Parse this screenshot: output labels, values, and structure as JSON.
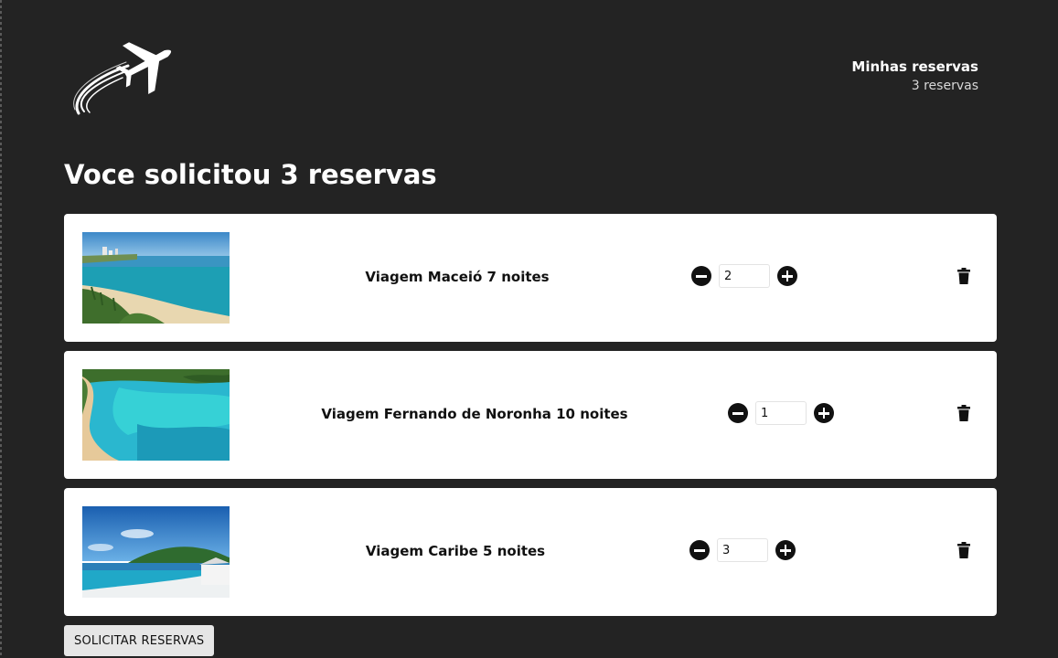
{
  "header": {
    "logo_icon": "airplane-logo-icon",
    "reservas_link_label": "Minhas reservas",
    "reservas_count": "3 reservas"
  },
  "main": {
    "title": "Voce solicitou 3 reservas",
    "reservations": [
      {
        "name": "Viagem Maceió 7 noites",
        "quantity": "2",
        "image": "maceio-beach-photo"
      },
      {
        "name": "Viagem Fernando de Noronha 10 noites",
        "quantity": "1",
        "image": "noronha-bay-photo"
      },
      {
        "name": "Viagem Caribe 5 noites",
        "quantity": "3",
        "image": "caribbean-beach-photo"
      }
    ],
    "submit_label": "SOLICITAR RESERVAS"
  },
  "icons": {
    "decrement": "minus-circle-icon",
    "increment": "plus-circle-icon",
    "delete": "trash-icon"
  },
  "colors": {
    "background": "#232323",
    "card": "#ffffff",
    "text_dark": "#111111",
    "button": "#e6e6e6"
  }
}
